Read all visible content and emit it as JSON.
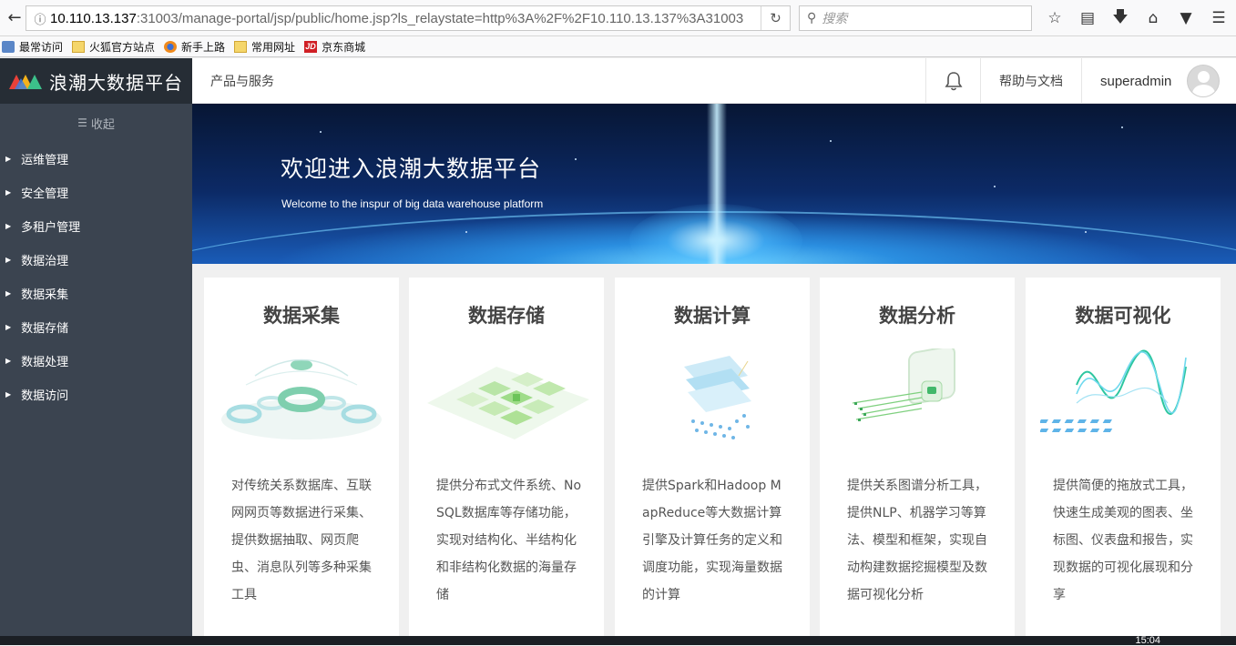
{
  "browser": {
    "url_host": "10.110.13.137",
    "url_path": ":31003/manage-portal/jsp/public/home.jsp?ls_relaystate=http%3A%2F%2F10.110.13.137%3A31003",
    "search_placeholder": "搜索",
    "bookmarks": [
      "最常访问",
      "火狐官方站点",
      "新手上路",
      "常用网址",
      "京东商城"
    ],
    "jd_badge": "JD"
  },
  "app": {
    "logo_text": "浪潮大数据平台",
    "collapse_label": "收起",
    "menu": [
      "运维管理",
      "安全管理",
      "多租户管理",
      "数据治理",
      "数据采集",
      "数据存储",
      "数据处理",
      "数据访问"
    ],
    "top_nav": {
      "products": "产品与服务",
      "help": "帮助与文档",
      "username": "superadmin"
    },
    "banner": {
      "title": "欢迎进入浪潮大数据平台",
      "subtitle": "Welcome to the inspur of big data warehouse platform"
    },
    "cards": [
      {
        "title": "数据采集",
        "desc": "对传统关系数据库、互联网网页等数据进行采集、提供数据抽取、网页爬虫、消息队列等多种采集工具"
      },
      {
        "title": "数据存储",
        "desc": "提供分布式文件系统、NoSQL数据库等存储功能，实现对结构化、半结构化和非结构化数据的海量存储"
      },
      {
        "title": "数据计算",
        "desc": "提供Spark和Hadoop MapReduce等大数据计算引擎及计算任务的定义和调度功能，实现海量数据的计算"
      },
      {
        "title": "数据分析",
        "desc": "提供关系图谱分析工具，提供NLP、机器学习等算法、模型和框架，实现自动构建数据挖掘模型及数据可视化分析"
      },
      {
        "title": "数据可视化",
        "desc": "提供简便的拖放式工具，快速生成美观的图表、坐标图、仪表盘和报告，实现数据的可视化展现和分享"
      }
    ]
  },
  "taskbar": {
    "clock": "15:04"
  },
  "colors": {
    "sidebar": "#3b4450",
    "sidebar_logo": "#262d35",
    "accent_green": "#3cc08a"
  }
}
